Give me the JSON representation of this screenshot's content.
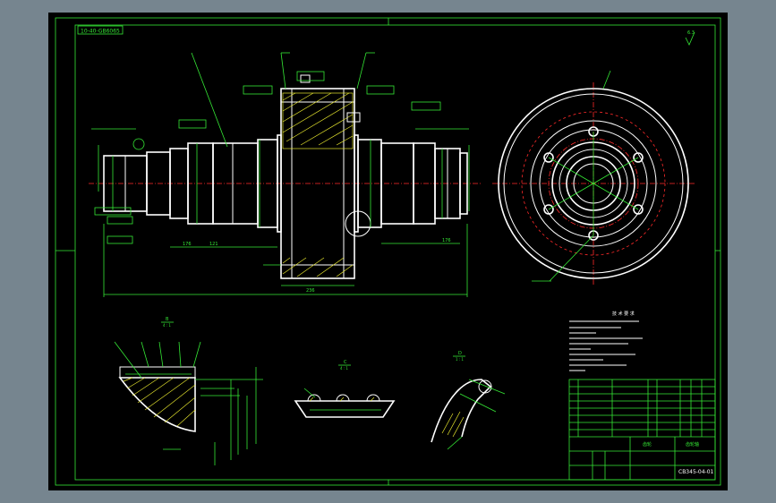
{
  "drawing": {
    "top_left_code": "10-40-GB6065",
    "surface_mark": "6.3",
    "part_number_cell": "CB345-04-01",
    "title_cell_1": "齿轮",
    "title_cell_2": "齿轮轴",
    "notes_title": "技 术 要 求",
    "view_b_label": "B",
    "view_b_scale": "4 : 1",
    "view_c_label": "C",
    "view_c_scale": "4 : 1",
    "view_d_label": "D",
    "view_d_scale": "1 : 1",
    "dim_total_length": "236",
    "dim_segment_a": "176",
    "dim_segment_b": "121",
    "dim_segment_c": "176"
  },
  "colors": {
    "background_outer": "#76858f",
    "sheet": "#000000",
    "geometry": "#ffffff",
    "dimensions": "#35e835",
    "centerlines": "#ff2a2a",
    "hatching": "#e6e62e"
  }
}
